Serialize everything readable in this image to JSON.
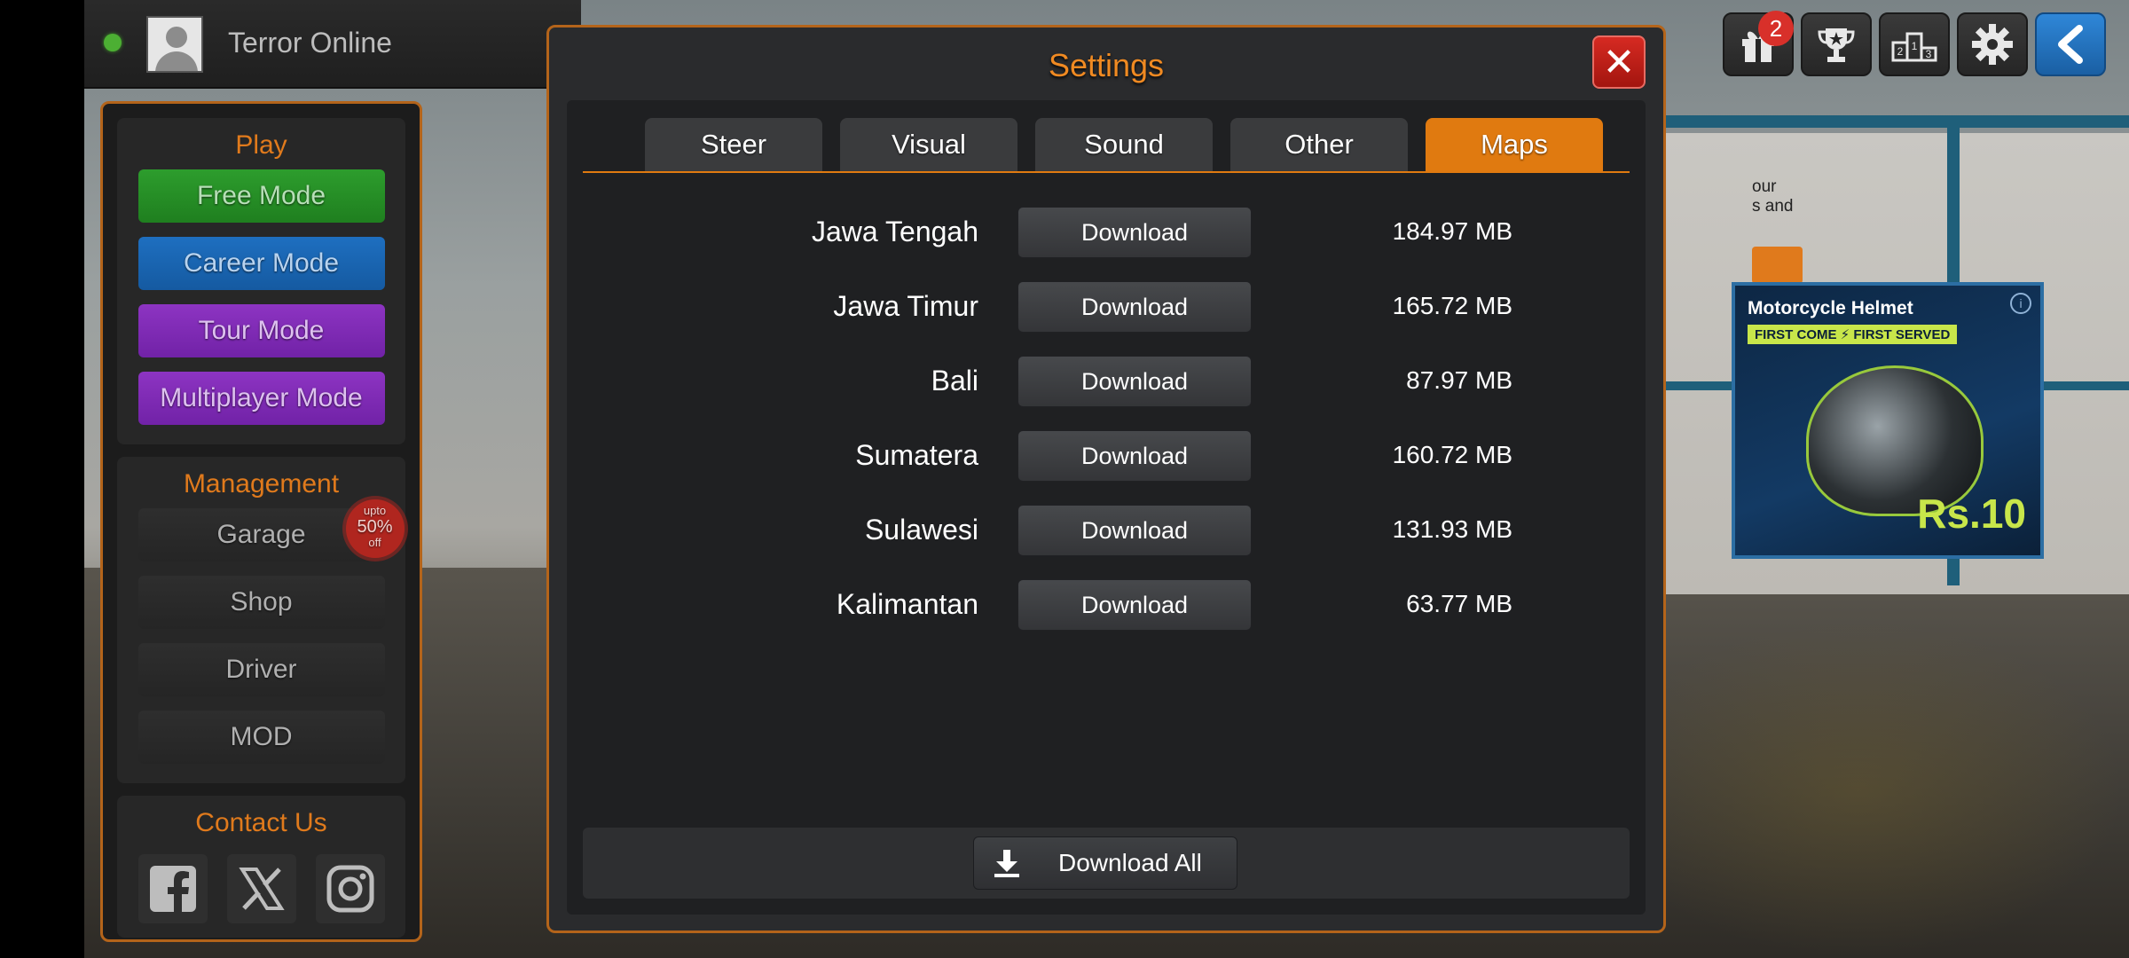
{
  "player": {
    "name": "Terror Online",
    "status": "online"
  },
  "top_icons": [
    {
      "icon": "gift-icon",
      "badge": "2"
    },
    {
      "icon": "trophy-icon"
    },
    {
      "icon": "leaderboard-icon"
    },
    {
      "icon": "gear-icon"
    },
    {
      "icon": "back-arrow-icon"
    }
  ],
  "menu": {
    "play_title": "Play",
    "play_items": [
      "Free Mode",
      "Career Mode",
      "Tour Mode",
      "Multiplayer Mode"
    ],
    "management_title": "Management",
    "management_items": [
      "Garage",
      "Shop",
      "Driver",
      "MOD"
    ],
    "promo": {
      "line1": "upto",
      "line2": "50%",
      "line3": "off"
    },
    "contact_title": "Contact Us",
    "social": [
      "facebook-icon",
      "x-icon",
      "instagram-icon"
    ]
  },
  "ad": {
    "title": "Motorcycle Helmet",
    "strip": "FIRST COME ⚡ FIRST SERVED",
    "price": "Rs.10",
    "info": "i",
    "side_text_1": "our",
    "side_text_2": "s and"
  },
  "settings": {
    "title": "Settings",
    "close": "✕",
    "tabs": [
      "Steer",
      "Visual",
      "Sound",
      "Other",
      "Maps"
    ],
    "active_tab": "Maps",
    "maps": [
      {
        "name": "Jawa Tengah",
        "button": "Download",
        "size": "184.97 MB"
      },
      {
        "name": "Jawa Timur",
        "button": "Download",
        "size": "165.72 MB"
      },
      {
        "name": "Bali",
        "button": "Download",
        "size": "87.97 MB"
      },
      {
        "name": "Sumatera",
        "button": "Download",
        "size": "160.72 MB"
      },
      {
        "name": "Sulawesi",
        "button": "Download",
        "size": "131.93 MB"
      },
      {
        "name": "Kalimantan",
        "button": "Download",
        "size": "63.77 MB"
      }
    ],
    "download_all": "Download All"
  },
  "colors": {
    "accent": "#e07a10",
    "title": "#f08a22",
    "close": "#c21c15",
    "free_mode": "#1f8a1f",
    "career_mode": "#1763b1",
    "tour_mode": "#7e2bb5",
    "multiplayer_mode": "#7e2bb5"
  }
}
